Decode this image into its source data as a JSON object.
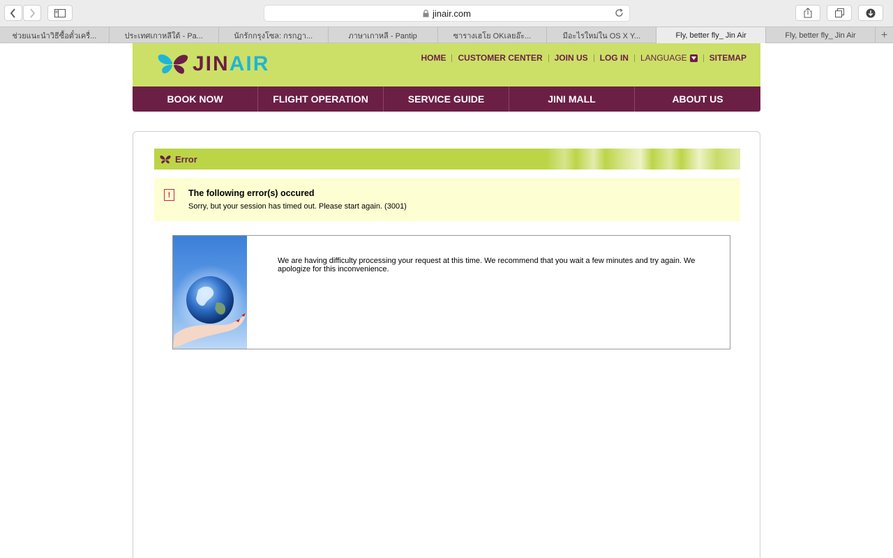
{
  "browser": {
    "url": "jinair.com",
    "tabs": [
      {
        "label": "ช่วยแนะนำวิธีซื้อตั๋วเครื่...",
        "active": false
      },
      {
        "label": "ประเทศเกาหลีใต้ - Pa...",
        "active": false
      },
      {
        "label": "นักรักกรุงโซล: กรกฎา...",
        "active": false
      },
      {
        "label": "ภาษาเกาหลี - Pantip",
        "active": false
      },
      {
        "label": "ซารางเฮโย OKเลยอ๊ะ...",
        "active": false
      },
      {
        "label": "มีอะไรใหม่ใน OS X Y...",
        "active": false
      },
      {
        "label": "Fly, better fly_ Jin Air",
        "active": true
      },
      {
        "label": "Fly, better fly_ Jin Air",
        "active": false
      }
    ],
    "new_tab": "+"
  },
  "site": {
    "logo": {
      "part1": "JIN",
      "part2": "AIR",
      "colors": {
        "jin": "#6c1f45",
        "air": "#1eb6d6"
      }
    },
    "topnav": {
      "home": "HOME",
      "customer_center": "CUSTOMER CENTER",
      "join_us": "JOIN US",
      "log_in": "LOG IN",
      "language": "LANGUAGE",
      "sitemap": "SITEMAP"
    },
    "mainnav": {
      "book_now": "BOOK NOW",
      "flight_operation": "FLIGHT OPERATION",
      "service_guide": "SERVICE GUIDE",
      "jini_mall": "JINI MALL",
      "about_us": "ABOUT US"
    },
    "colors": {
      "header_bg": "#cce067",
      "nav_bg": "#6c1f45",
      "error_box_bg": "#fefed3"
    }
  },
  "error": {
    "title": "Error",
    "icon": "exclamation-icon",
    "heading": "The following error(s) occured",
    "message": "Sorry, but your session has timed out. Please start again. (3001)"
  },
  "notice": {
    "text": "We are having difficulty processing your request at this time. We recommend that you wait a few minutes and try again. We apologize for this inconvenience."
  }
}
